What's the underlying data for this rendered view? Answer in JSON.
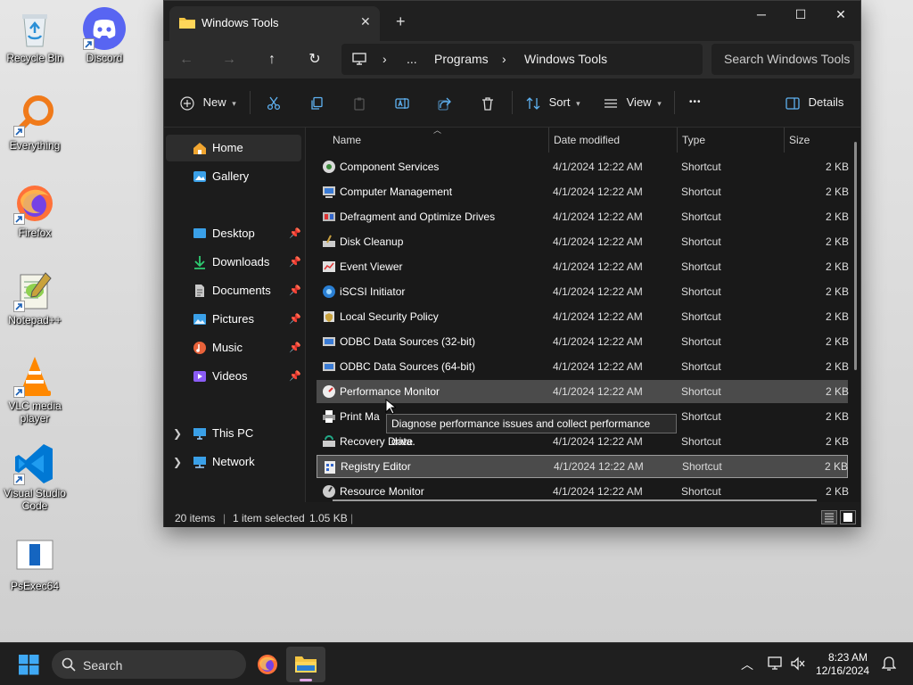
{
  "desktop": {
    "icons": [
      {
        "label": "Recycle Bin",
        "icon": "recycle-bin-icon"
      },
      {
        "label": "Discord",
        "icon": "discord-icon"
      },
      {
        "label": "Everything",
        "icon": "everything-search-icon"
      },
      {
        "label": "Firefox",
        "icon": "firefox-icon"
      },
      {
        "label": "Notepad++",
        "icon": "notepad-plus-plus-icon"
      },
      {
        "label": "VLC media player",
        "icon": "vlc-icon"
      },
      {
        "label": "Visual Studio Code",
        "icon": "vscode-icon"
      },
      {
        "label": "PsExec64",
        "icon": "psexec-icon"
      }
    ]
  },
  "window": {
    "tab_title": "Windows Tools",
    "breadcrumb": [
      "...",
      "Programs",
      "Windows Tools"
    ],
    "search_placeholder": "Search Windows Tools"
  },
  "command_bar": {
    "new_label": "New",
    "sort_label": "Sort",
    "view_label": "View",
    "more_label": "•••",
    "details_label": "Details"
  },
  "nav": {
    "home": "Home",
    "gallery": "Gallery",
    "pinned": [
      "Desktop",
      "Downloads",
      "Documents",
      "Pictures",
      "Music",
      "Videos"
    ],
    "this_pc": "This PC",
    "network": "Network"
  },
  "columns": [
    "Name",
    "Date modified",
    "Type",
    "Size"
  ],
  "files": [
    {
      "name": "Component Services",
      "date": "4/1/2024 12:22 AM",
      "type": "Shortcut",
      "size": "2 KB"
    },
    {
      "name": "Computer Management",
      "date": "4/1/2024 12:22 AM",
      "type": "Shortcut",
      "size": "2 KB"
    },
    {
      "name": "Defragment and Optimize Drives",
      "date": "4/1/2024 12:22 AM",
      "type": "Shortcut",
      "size": "2 KB"
    },
    {
      "name": "Disk Cleanup",
      "date": "4/1/2024 12:22 AM",
      "type": "Shortcut",
      "size": "2 KB"
    },
    {
      "name": "Event Viewer",
      "date": "4/1/2024 12:22 AM",
      "type": "Shortcut",
      "size": "2 KB"
    },
    {
      "name": "iSCSI Initiator",
      "date": "4/1/2024 12:22 AM",
      "type": "Shortcut",
      "size": "2 KB"
    },
    {
      "name": "Local Security Policy",
      "date": "4/1/2024 12:22 AM",
      "type": "Shortcut",
      "size": "2 KB"
    },
    {
      "name": "ODBC Data Sources (32-bit)",
      "date": "4/1/2024 12:22 AM",
      "type": "Shortcut",
      "size": "2 KB"
    },
    {
      "name": "ODBC Data Sources (64-bit)",
      "date": "4/1/2024 12:22 AM",
      "type": "Shortcut",
      "size": "2 KB"
    },
    {
      "name": "Performance Monitor",
      "date": "4/1/2024 12:22 AM",
      "type": "Shortcut",
      "size": "2 KB"
    },
    {
      "name": "Print Ma",
      "date": "",
      "type": "Shortcut",
      "size": "2 KB"
    },
    {
      "name": "Recovery Drive",
      "date": "4/1/2024 12:22 AM",
      "type": "Shortcut",
      "size": "2 KB"
    },
    {
      "name": "Registry Editor",
      "date": "4/1/2024 12:22 AM",
      "type": "Shortcut",
      "size": "2 KB"
    },
    {
      "name": "Resource Monitor",
      "date": "4/1/2024 12:22 AM",
      "type": "Shortcut",
      "size": "2 KB"
    }
  ],
  "tooltip": "Diagnose performance issues and collect performance data.",
  "status": {
    "count": "20 items",
    "selection": "1 item selected",
    "size": "1.05 KB"
  },
  "taskbar": {
    "search_label": "Search",
    "time": "8:23 AM",
    "date": "12/16/2024"
  }
}
